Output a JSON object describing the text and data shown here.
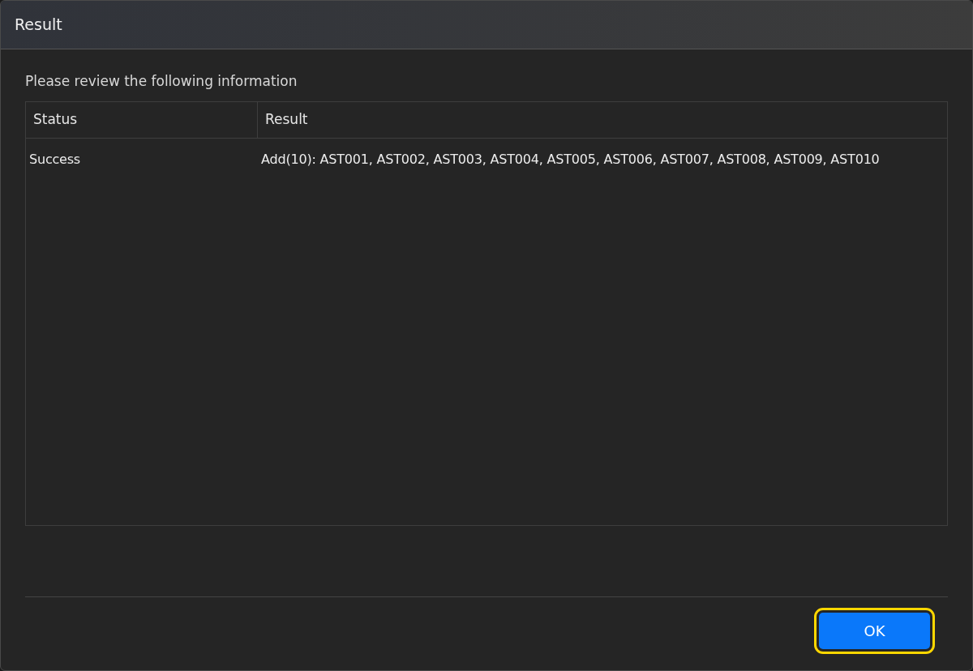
{
  "window": {
    "title": "Result"
  },
  "message": "Please review the following information",
  "table": {
    "columns": [
      "Status",
      "Result"
    ],
    "rows": [
      {
        "cells": [
          "Success",
          "Add(10): AST001, AST002, AST003, AST004, AST005, AST006, AST007, AST008, AST009, AST010"
        ]
      }
    ]
  },
  "buttons": [
    {
      "label": "OK",
      "focused": true
    }
  ]
}
